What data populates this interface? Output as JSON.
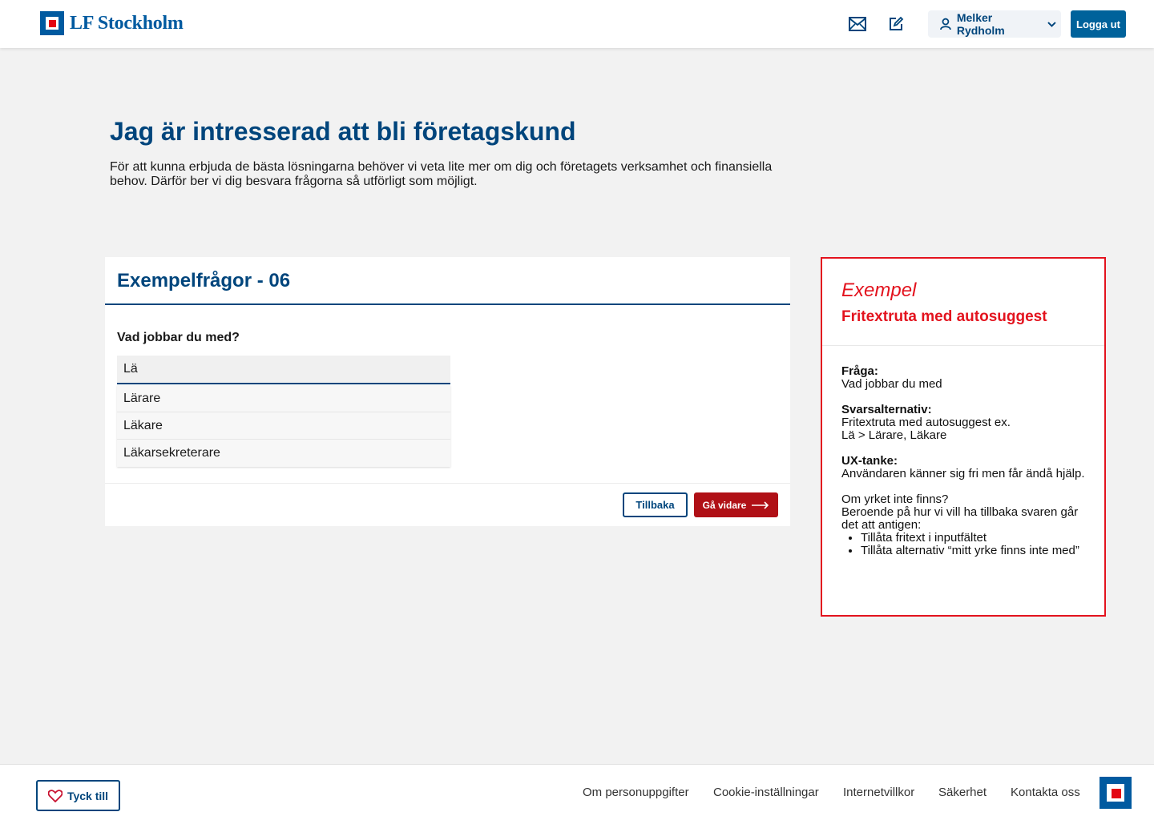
{
  "header": {
    "logo_text": "LF Stockholm",
    "mail_icon": "mail-icon",
    "edit_icon": "edit-icon",
    "user_name": "Melker Rydholm",
    "logout_label": "Logga ut"
  },
  "intro": {
    "title": "Jag är intresserad att bli företagskund",
    "text": "För att kunna erbjuda de bästa lösningarna behöver vi veta lite mer om dig och företagets verksamhet och finansiella behov. Därför ber vi dig besvara frågorna så utförligt som möjligt."
  },
  "card": {
    "title": "Exempelfrågor - 06",
    "question": "Vad jobbar du med?",
    "input_value": "Lä",
    "suggestions": [
      "Lärare",
      "Läkare",
      "Läkarsekreterare"
    ],
    "back_label": "Tillbaka",
    "next_label": "Gå vidare"
  },
  "example": {
    "heading": "Exempel",
    "subheading": "Fritextruta med autosuggest",
    "question_label": "Fråga:",
    "question_text": "Vad jobbar du med",
    "answers_label": "Svarsalternativ:",
    "answers_line1": "Fritextruta med autosuggest ex.",
    "answers_line2": "Lä > Lärare, Läkare",
    "ux_label": "UX-tanke:",
    "ux_text": "Användaren känner sig fri men får ändå hjälp.",
    "missing_q": "Om yrket inte finns?",
    "missing_text": "Beroende på hur vi vill ha tillbaka svaren går det att antigen:",
    "bullets": [
      "Tillåta fritext i inputfältet",
      "Tillåta alternativ “mitt yrke finns inte med”"
    ]
  },
  "footer": {
    "feedback_label": "Tyck till",
    "links": [
      "Om personuppgifter",
      "Cookie-inställningar",
      "Internetvillkor",
      "Säkerhet",
      "Kontakta oss"
    ]
  },
  "colors": {
    "brand_blue": "#00457c",
    "brand_red": "#e3131e",
    "button_red": "#b01016"
  }
}
